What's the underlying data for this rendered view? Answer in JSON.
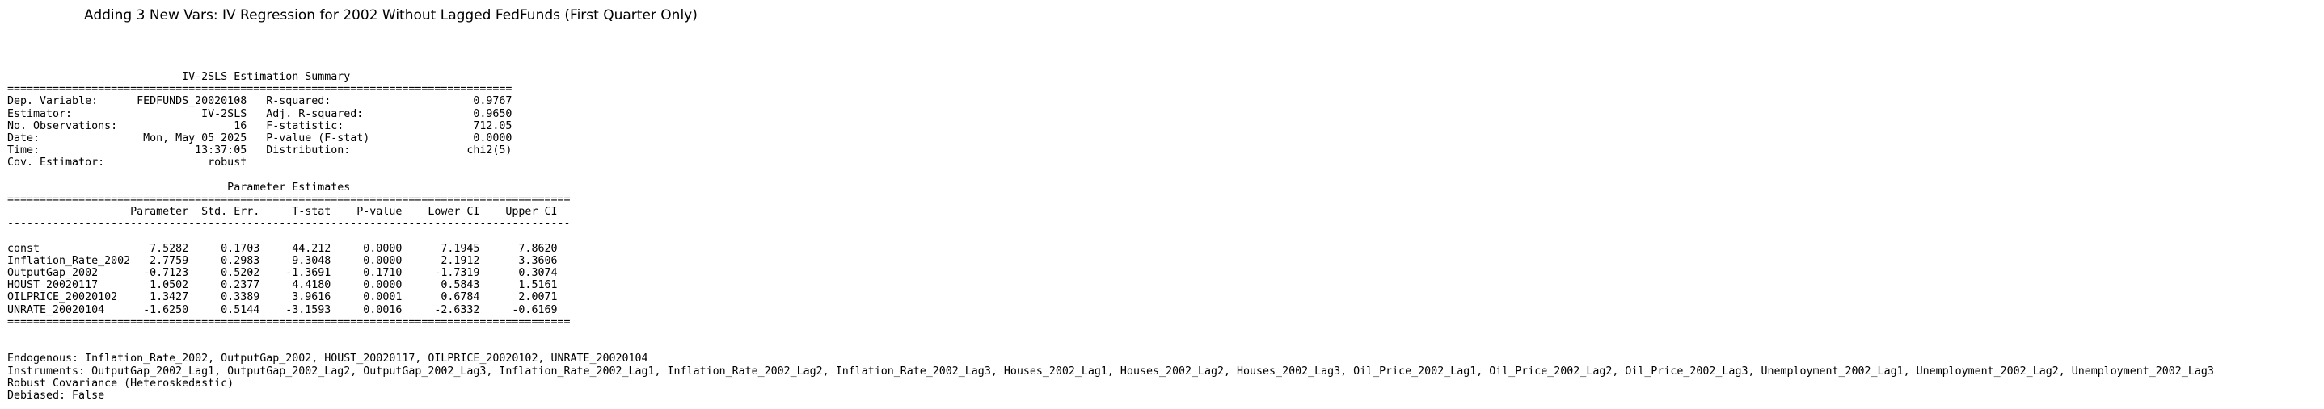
{
  "title": "Adding 3 New Vars: IV Regression for 2002 Without Lagged FedFunds (First Quarter Only)",
  "summary": {
    "heading": "                           IV-2SLS Estimation Summary                          ",
    "separator": "==============================================================================",
    "rows": [
      "Dep. Variable:      FEDFUNDS_20020108   R-squared:                      0.9767",
      "Estimator:                    IV-2SLS   Adj. R-squared:                 0.9650",
      "No. Observations:                  16   F-statistic:                    712.05",
      "Date:                Mon, May 05 2025   P-value (F-stat)                0.0000",
      "Time:                        13:37:05   Distribution:                  chi2(5)",
      "Cov. Estimator:                robust                                         "
    ]
  },
  "params": {
    "heading": "                                  Parameter Estimates                                  ",
    "separator": "=======================================================================================",
    "header": "                   Parameter  Std. Err.     T-stat    P-value    Lower CI    Upper CI",
    "dash": "---------------------------------------------------------------------------------------",
    "rows": [
      "const                 7.5282     0.1703     44.212     0.0000      7.1945      7.8620",
      "Inflation_Rate_2002   2.7759     0.2983     9.3048     0.0000      2.1912      3.3606",
      "OutputGap_2002       -0.7123     0.5202    -1.3691     0.1710     -1.7319      0.3074",
      "HOUST_20020117        1.0502     0.2377     4.4180     0.0000      0.5843      1.5161",
      "OILPRICE_20020102     1.3427     0.3389     3.9616     0.0001      0.6784      2.0071",
      "UNRATE_20020104      -1.6250     0.5144    -3.1593     0.0016     -2.6332     -0.6169"
    ],
    "bottom_separator": "======================================================================================="
  },
  "notes": {
    "endogenous": "Endogenous: Inflation_Rate_2002, OutputGap_2002, HOUST_20020117, OILPRICE_20020102, UNRATE_20020104",
    "instruments": "Instruments: OutputGap_2002_Lag1, OutputGap_2002_Lag2, OutputGap_2002_Lag3, Inflation_Rate_2002_Lag1, Inflation_Rate_2002_Lag2, Inflation_Rate_2002_Lag3, Houses_2002_Lag1, Houses_2002_Lag2, Houses_2002_Lag3, Oil_Price_2002_Lag1, Oil_Price_2002_Lag2, Oil_Price_2002_Lag3, Unemployment_2002_Lag1, Unemployment_2002_Lag2, Unemployment_2002_Lag3",
    "robust": "Robust Covariance (Heteroskedastic)",
    "debiased": "Debiased: False"
  }
}
